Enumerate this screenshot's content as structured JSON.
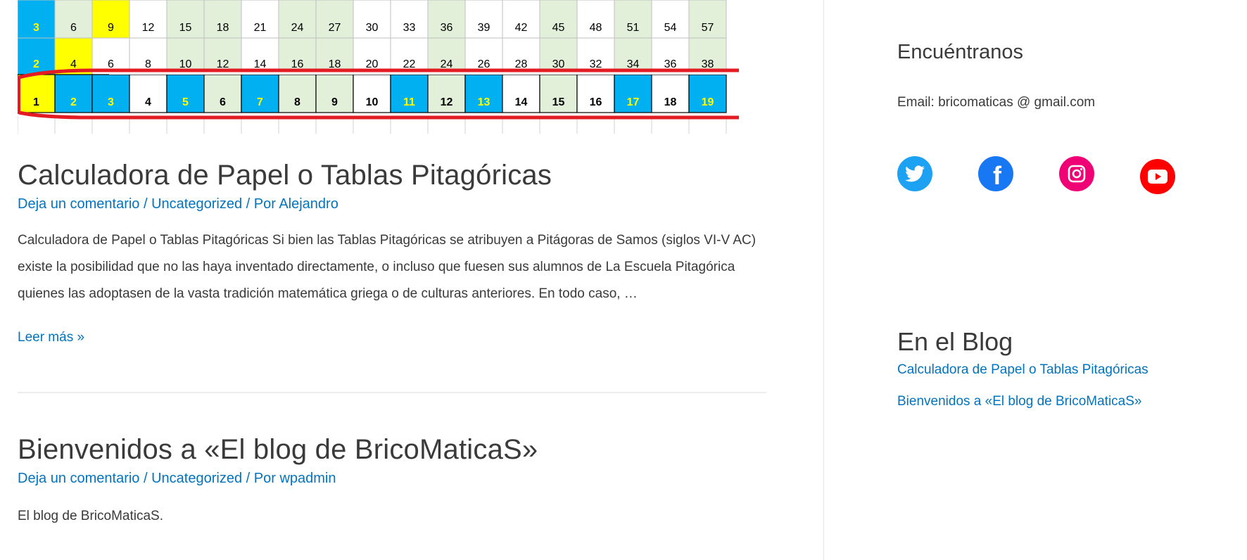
{
  "table": {
    "row_top": [
      "3",
      "6",
      "9",
      "12",
      "15",
      "18",
      "21",
      "24",
      "27",
      "30",
      "33",
      "36",
      "39",
      "42",
      "45",
      "48",
      "51",
      "54",
      "57"
    ],
    "row_mid": [
      "2",
      "4",
      "6",
      "8",
      "10",
      "12",
      "14",
      "16",
      "18",
      "20",
      "22",
      "24",
      "26",
      "28",
      "30",
      "32",
      "34",
      "36",
      "38"
    ],
    "row_bottom": [
      "1",
      "2",
      "3",
      "4",
      "5",
      "6",
      "7",
      "8",
      "9",
      "10",
      "11",
      "12",
      "13",
      "14",
      "15",
      "16",
      "17",
      "18",
      "19"
    ]
  },
  "posts": [
    {
      "title": "Calculadora de Papel o Tablas Pitagóricas",
      "meta": {
        "comment": "Deja un comentario",
        "sep1": " / ",
        "category": "Uncategorized",
        "sep2": " / Por ",
        "author": "Alejandro"
      },
      "excerpt": "Calculadora de Papel o Tablas Pitagóricas Si bien las Tablas Pitagóricas se atribuyen a Pitágoras de Samos (siglos VI-V AC) existe la posibilidad que no las haya inventado directamente, o incluso que fuesen sus alumnos de La Escuela Pitagórica quienes las adoptasen de la vasta tradición matemática griega o de culturas anteriores. En todo caso, …",
      "read_more": "Leer más »"
    },
    {
      "title": "Bienvenidos a «El blog de BricoMaticaS»",
      "meta": {
        "comment": "Deja un comentario",
        "sep1": " / ",
        "category": "Uncategorized",
        "sep2": " / Por ",
        "author": "wpadmin"
      },
      "excerpt": "El blog de BricoMaticaS."
    }
  ],
  "sidebar": {
    "find_us": {
      "title": "Encuéntranos",
      "email": "Email: bricomaticas @ gmail.com"
    },
    "social": [
      {
        "name": "twitter-icon",
        "color": "#1da1f2"
      },
      {
        "name": "facebook-icon",
        "color": "#1877f2"
      },
      {
        "name": "instagram-icon",
        "color": "#f00075"
      },
      {
        "name": "youtube-icon",
        "color": "#ff0000"
      }
    ],
    "blog": {
      "title": "En el Blog",
      "links": [
        "Calculadora de Papel o Tablas Pitagóricas",
        "Bienvenidos a «El blog de BricoMaticaS»"
      ]
    }
  }
}
